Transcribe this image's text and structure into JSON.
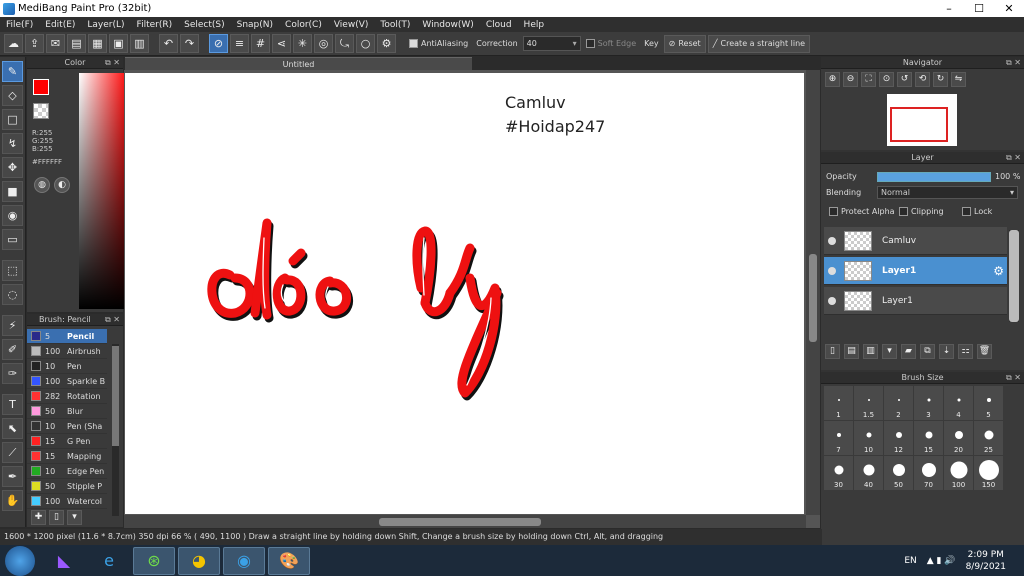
{
  "window": {
    "title": "MediBang Paint Pro (32bit)"
  },
  "menu": [
    "File(F)",
    "Edit(E)",
    "Layer(L)",
    "Filter(R)",
    "Select(S)",
    "Snap(N)",
    "Color(C)",
    "View(V)",
    "Tool(T)",
    "Window(W)",
    "Cloud",
    "Help"
  ],
  "toolbar": {
    "antialiasing_label": "AntiAliasing",
    "correction_label": "Correction",
    "correction_value": "40",
    "soft_edge_label": "Soft Edge",
    "key_label": "Key",
    "reset_label": "Reset",
    "straight_line_label": "Create a straight line"
  },
  "color_panel": {
    "title": "Color",
    "r": "R:255",
    "g": "G:255",
    "b": "B:255",
    "hex": "#FFFFFF",
    "foreground": "#ff0000"
  },
  "brush_panel": {
    "title": "Brush: Pencil",
    "items": [
      {
        "size": "5",
        "name": "Pencil",
        "color": "#2a2a8a"
      },
      {
        "size": "100",
        "name": "Airbrush",
        "color": "#bbbbbb"
      },
      {
        "size": "10",
        "name": "Pen",
        "color": "#222222"
      },
      {
        "size": "100",
        "name": "Sparkle B",
        "color": "#3355ff"
      },
      {
        "size": "282",
        "name": "Rotation",
        "color": "#ff3333"
      },
      {
        "size": "50",
        "name": "Blur",
        "color": "#ff99dd"
      },
      {
        "size": "10",
        "name": "Pen (Sha",
        "color": "#333333"
      },
      {
        "size": "15",
        "name": "G Pen",
        "color": "#ff2222"
      },
      {
        "size": "15",
        "name": "Mapping",
        "color": "#ff3333"
      },
      {
        "size": "10",
        "name": "Edge Pen",
        "color": "#22aa22"
      },
      {
        "size": "50",
        "name": "Stipple P",
        "color": "#dddd22"
      },
      {
        "size": "100",
        "name": "Watercol",
        "color": "#44ccff"
      }
    ]
  },
  "document": {
    "tab": "Untitled",
    "canvas_text_1": "Camluv",
    "canvas_text_2": "#Hoidap247"
  },
  "navigator": {
    "title": "Navigator"
  },
  "layer_panel": {
    "title": "Layer",
    "opacity_label": "Opacity",
    "opacity_value": "100 %",
    "opacity_level": 1.0,
    "blending_label": "Blending",
    "blending_value": "Normal",
    "protect_alpha": "Protect Alpha",
    "clipping": "Clipping",
    "lock": "Lock",
    "layers": [
      {
        "name": "Camluv",
        "selected": false
      },
      {
        "name": "Layer1",
        "selected": true
      },
      {
        "name": "Layer1",
        "selected": false
      }
    ]
  },
  "brush_size": {
    "title": "Brush Size",
    "sizes": [
      "1",
      "1.5",
      "2",
      "3",
      "4",
      "5",
      "7",
      "10",
      "12",
      "15",
      "20",
      "25",
      "30",
      "40",
      "50",
      "70",
      "100",
      "150"
    ]
  },
  "status": {
    "text": "1600 * 1200 pixel  (11.6 * 8.7cm)  350 dpi  66 %  ( 490, 1100 )  Draw a straight line by holding down Shift, Change a brush size by holding down Ctrl, Alt, and dragging"
  },
  "taskbar": {
    "lang": "EN",
    "time": "2:09 PM",
    "date": "8/9/2021"
  }
}
